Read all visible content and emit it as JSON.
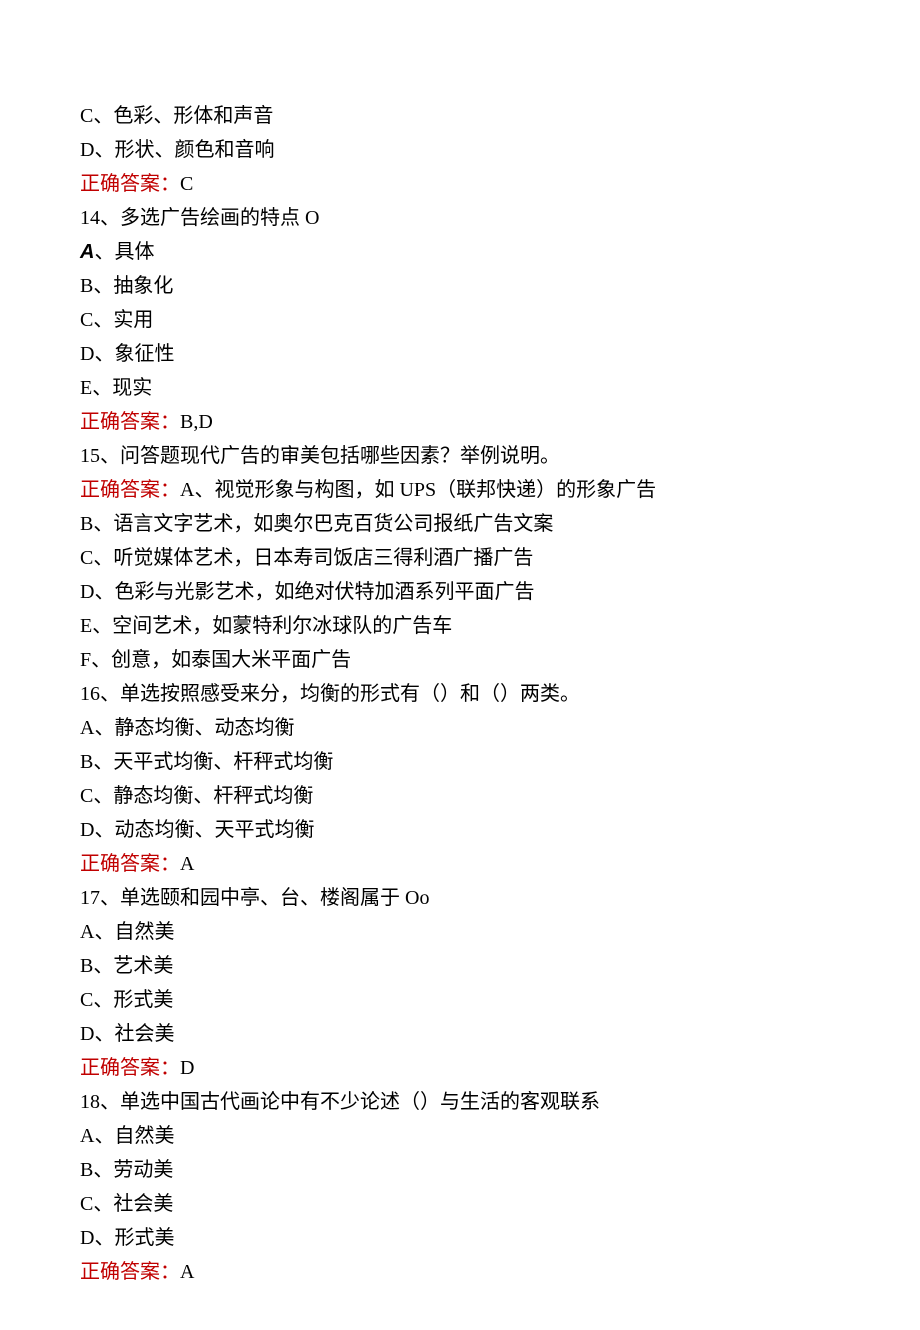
{
  "lines": [
    {
      "type": "text",
      "content": "C、色彩、形体和声音"
    },
    {
      "type": "text",
      "content": "D、形状、颜色和音响"
    },
    {
      "type": "answer",
      "label": "正确答案：",
      "value": "C"
    },
    {
      "type": "text",
      "content": "14、多选广告绘画的特点 O"
    },
    {
      "type": "option-a",
      "prefix": "A",
      "suffix": "、具体"
    },
    {
      "type": "text",
      "content": "B、抽象化"
    },
    {
      "type": "text",
      "content": "C、实用"
    },
    {
      "type": "text",
      "content": "D、象征性"
    },
    {
      "type": "text",
      "content": "E、现实"
    },
    {
      "type": "answer",
      "label": "正确答案：",
      "value": "B,D"
    },
    {
      "type": "text",
      "content": "15、问答题现代广告的审美包括哪些因素？举例说明。"
    },
    {
      "type": "answer",
      "label": "正确答案：",
      "value": "A、视觉形象与构图，如 UPS（联邦快递）的形象广告"
    },
    {
      "type": "text",
      "content": "B、语言文字艺术，如奥尔巴克百货公司报纸广告文案"
    },
    {
      "type": "text",
      "content": "C、听觉媒体艺术，日本寿司饭店三得利酒广播广告"
    },
    {
      "type": "text",
      "content": "D、色彩与光影艺术，如绝对伏特加酒系列平面广告"
    },
    {
      "type": "text",
      "content": "E、空间艺术，如蒙特利尔冰球队的广告车"
    },
    {
      "type": "text",
      "content": "F、创意，如泰国大米平面广告"
    },
    {
      "type": "text",
      "content": "16、单选按照感受来分，均衡的形式有（）和（）两类。"
    },
    {
      "type": "text",
      "content": "A、静态均衡、动态均衡"
    },
    {
      "type": "text",
      "content": "B、天平式均衡、杆秤式均衡"
    },
    {
      "type": "text",
      "content": "C、静态均衡、杆秤式均衡"
    },
    {
      "type": "text",
      "content": "D、动态均衡、天平式均衡"
    },
    {
      "type": "answer",
      "label": "正确答案：",
      "value": "A"
    },
    {
      "type": "text",
      "content": "17、单选颐和园中亭、台、楼阁属于 Oo"
    },
    {
      "type": "text",
      "content": "A、自然美"
    },
    {
      "type": "text",
      "content": "B、艺术美"
    },
    {
      "type": "text",
      "content": "C、形式美"
    },
    {
      "type": "text",
      "content": "D、社会美"
    },
    {
      "type": "answer",
      "label": "正确答案：",
      "value": "D"
    },
    {
      "type": "text",
      "content": "18、单选中国古代画论中有不少论述（）与生活的客观联系"
    },
    {
      "type": "text",
      "content": "A、自然美"
    },
    {
      "type": "text",
      "content": "B、劳动美"
    },
    {
      "type": "text",
      "content": "C、社会美"
    },
    {
      "type": "text",
      "content": "D、形式美"
    },
    {
      "type": "answer",
      "label": "正确答案：",
      "value": "A"
    }
  ]
}
